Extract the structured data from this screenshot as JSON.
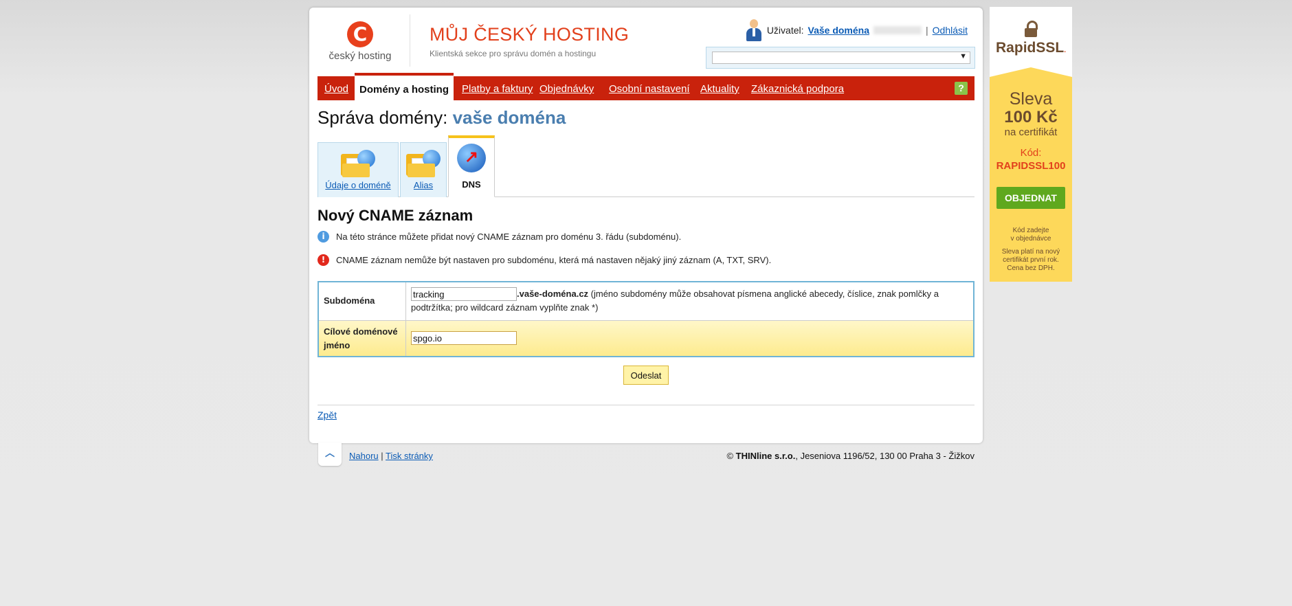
{
  "logo": {
    "text": "český hosting",
    "glyph": "C"
  },
  "header": {
    "title": "MŮJ ČESKÝ HOSTING",
    "subtitle": "Klientská sekce pro správu domén a hostingu"
  },
  "user": {
    "label": "Uživatel:",
    "name": "Vaše doména",
    "separator": "|",
    "logout": "Odhlásit"
  },
  "nav": {
    "items": [
      "Úvod",
      "Domény a hosting",
      "Platby a faktury",
      "Objednávky",
      "Osobní nastavení",
      "Aktuality",
      "Zákaznická podpora"
    ],
    "active": "Domény a hosting",
    "help": "?"
  },
  "page": {
    "title_prefix": "Správa domény:",
    "domain": "vaše doména"
  },
  "tabs": {
    "udaje": "Údaje o doméně",
    "alias": "Alias",
    "dns": "DNS"
  },
  "section": {
    "title": "Nový CNAME záznam"
  },
  "messages": {
    "info": "Na této stránce můžete přidat nový CNAME záznam pro doménu 3. řádu (subdoménu).",
    "error": "CNAME záznam nemůže být nastaven pro subdoménu, která má nastaven nějaký jiný záznam (A, TXT, SRV)."
  },
  "form": {
    "subdomain_label": "Subdoména",
    "subdomain_value": "tracking",
    "domain_suffix": ".vaše-doména.cz",
    "subdomain_hint": " (jméno subdomény může obsahovat písmena anglické abecedy, číslice, znak pomlčky a podtržítka; pro wildcard záznam vyplňte znak *)",
    "target_label": "Cílové doménové jméno",
    "target_value": "spgo.io",
    "submit": "Odeslat"
  },
  "back": "Zpět",
  "footer": {
    "up": "Nahoru",
    "sep": "|",
    "print": "Tisk stránky",
    "copy_symbol": "©",
    "company": "THINline s.r.o.",
    "address": ", Jeseniova 1196/52, 130 00 Praha 3 - Žižkov"
  },
  "ad": {
    "brand": "RapidSSL",
    "brand_mark": ".",
    "sleva": "Sleva",
    "amount": "100 Kč",
    "cert": "na certifikát",
    "kod_label": "Kód:",
    "code": "RAPIDSSL100",
    "button": "OBJEDNAT",
    "note1a": "Kód zadejte",
    "note1b": "v objednávce",
    "note2a": "Sleva platí na nový",
    "note2b": "certifikát první rok.",
    "note2c": "Cena bez DPH."
  },
  "colors": {
    "nav": "#c9220c",
    "brand": "#e2401c",
    "domain": "#4a7eaf",
    "ad_bg": "#fdd85a"
  }
}
